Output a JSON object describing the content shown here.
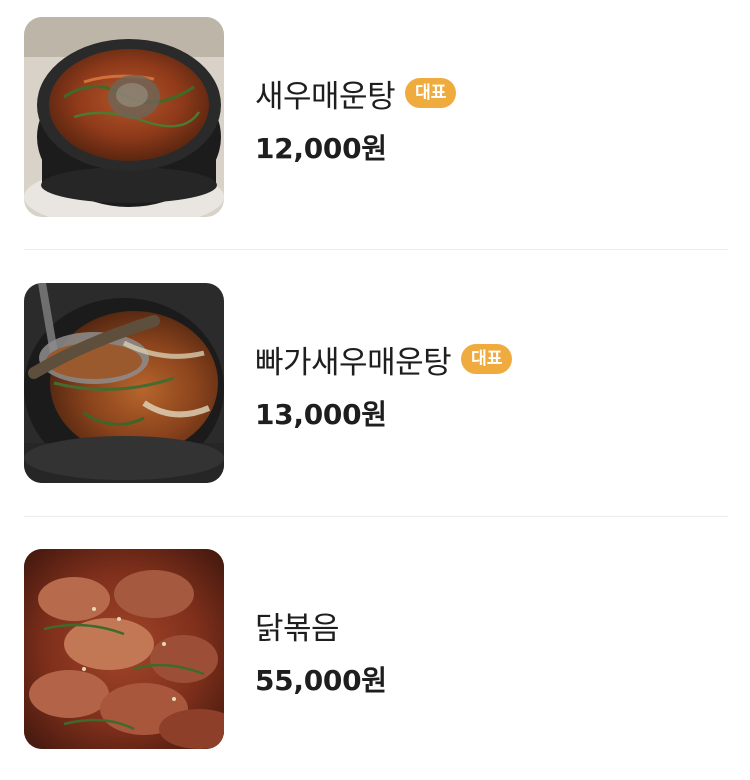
{
  "menu": {
    "items": [
      {
        "name": "새우매운탕",
        "badge": "대표",
        "price": "12,000원",
        "image": "spicy-shrimp-stew-in-stone-pot"
      },
      {
        "name": "빠가새우매운탕",
        "badge": "대표",
        "price": "13,000원",
        "image": "catfish-shrimp-stew-with-ladle"
      },
      {
        "name": "닭볶음",
        "badge": "",
        "price": "55,000원",
        "image": "braised-spicy-chicken"
      }
    ]
  },
  "colors": {
    "badge": "#f0ab3f",
    "divider": "#ececec",
    "text": "#1e1e1e"
  }
}
